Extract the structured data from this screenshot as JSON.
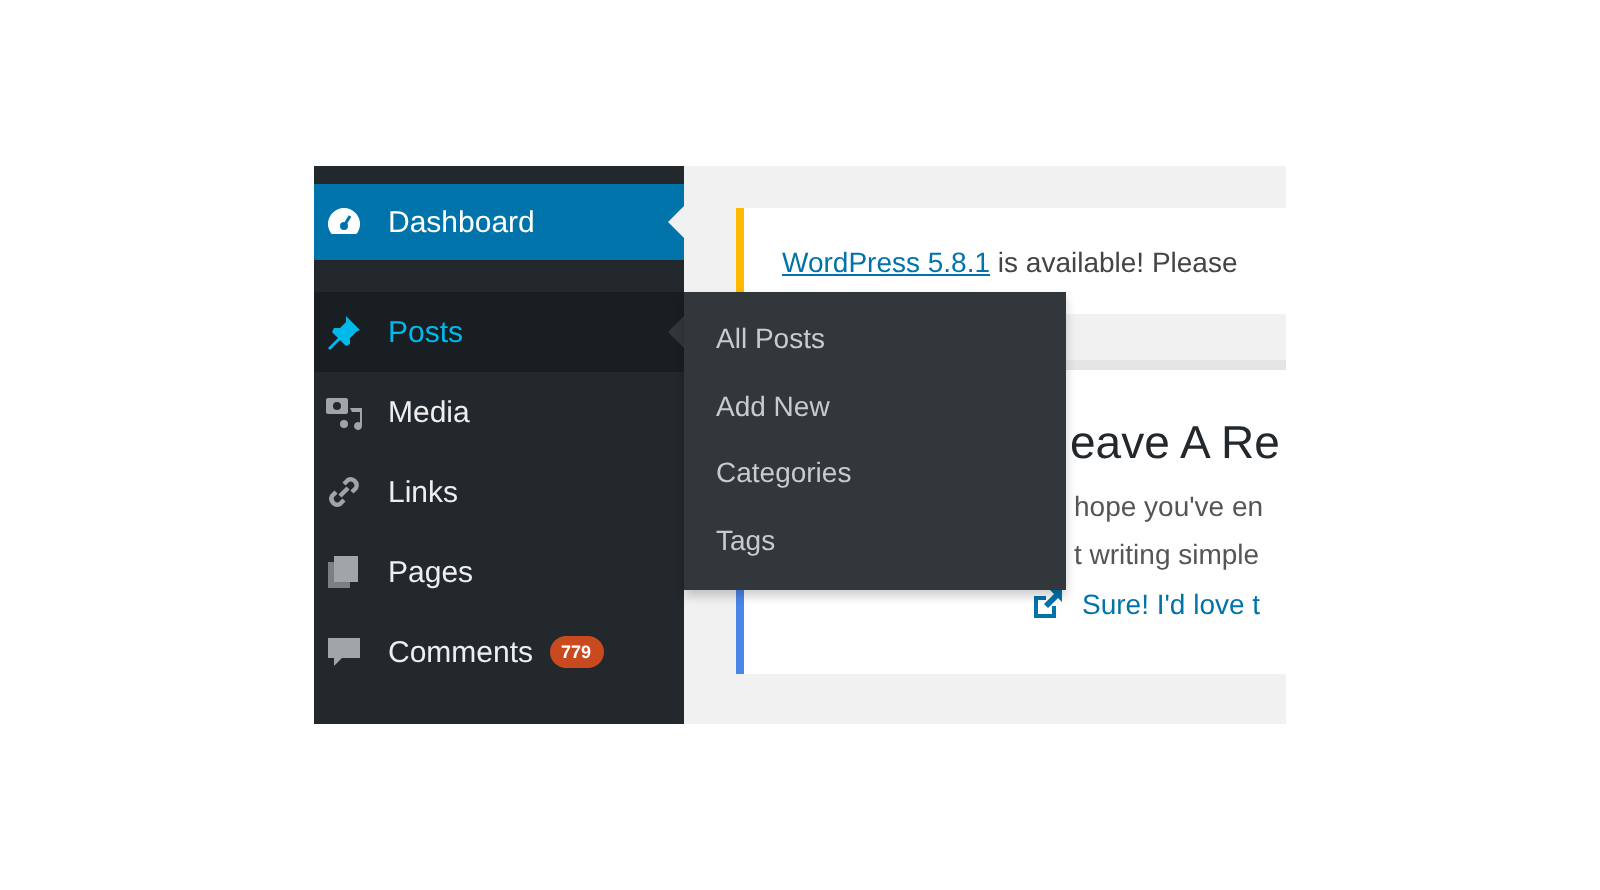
{
  "sidebar": {
    "items": [
      {
        "kind": "dashboard",
        "label": "Dashboard",
        "selected": true,
        "expanded": false
      },
      {
        "kind": "pin",
        "label": "Posts",
        "selected": false,
        "expanded": true,
        "submenu": [
          "All Posts",
          "Add New",
          "Categories",
          "Tags"
        ]
      },
      {
        "kind": "media",
        "label": "Media",
        "selected": false,
        "expanded": false
      },
      {
        "kind": "link",
        "label": "Links",
        "selected": false,
        "expanded": false
      },
      {
        "kind": "pages",
        "label": "Pages",
        "selected": false,
        "expanded": false
      },
      {
        "kind": "comment",
        "label": "Comments",
        "selected": false,
        "expanded": false,
        "badge": "779"
      }
    ]
  },
  "notice": {
    "link": "WordPress 5.8.1",
    "text": " is available! Please"
  },
  "card": {
    "heading": "eave A Re",
    "lines": [
      "hope you've en",
      "t writing simple"
    ],
    "action": "Sure! I'd love t"
  }
}
